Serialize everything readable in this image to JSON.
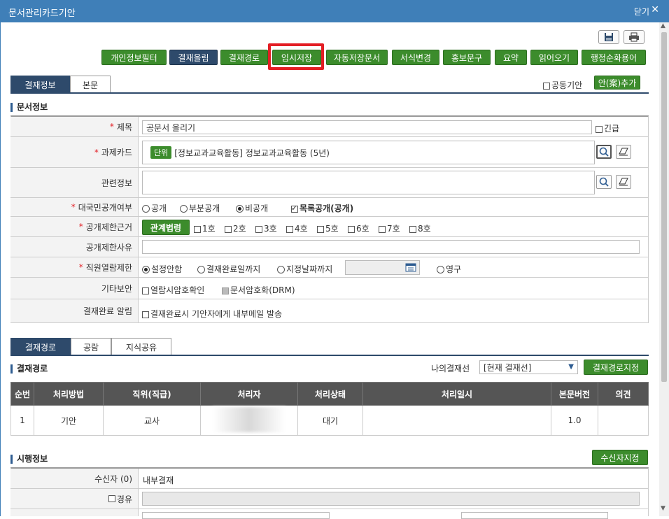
{
  "window": {
    "title": "문서관리카드기안",
    "close_label": "닫기"
  },
  "toolbar": {
    "buttons": [
      "개인정보필터",
      "결재올림",
      "결재경로",
      "임시저장",
      "자동저장문서",
      "서식변경",
      "홍보문구",
      "요약",
      "읽어오기",
      "행정순화용어"
    ]
  },
  "tabs_top": [
    "결재정보",
    "본문"
  ],
  "joint_draft_label": "공동기안",
  "add_draft_label": "안(案)추가",
  "doc_info": {
    "section_title": "문서정보",
    "title_label": "제목",
    "title_value": "공문서 올리기",
    "urgent_label": "긴급",
    "task_card_label": "과제카드",
    "task_tag": "단위",
    "task_value": "[정보교과교육활동] 정보교과교육활동 (5년)",
    "related_label": "관련정보",
    "public_label": "대국민공개여부",
    "public_options": [
      "공개",
      "부분공개",
      "비공개"
    ],
    "list_public_label": "목록공개(공개)",
    "restrict_basis_label": "공개제한근거",
    "law_button": "관계법령",
    "clauses": [
      "1호",
      "2호",
      "3호",
      "4호",
      "5호",
      "6호",
      "7호",
      "8호"
    ],
    "restrict_reason_label": "공개제한사유",
    "staff_view_label": "직원열람제한",
    "staff_view_options": [
      "설정안함",
      "결재완료일까지",
      "지정날짜까지"
    ],
    "permanent_label": "영구",
    "etc_security_label": "기타보안",
    "view_password_label": "열람시암호확인",
    "drm_label": "문서암호화(DRM)",
    "complete_notice_label": "결재완료 알림",
    "complete_notice_text": "결재완료시 기안자에게 내부메일 발송"
  },
  "tabs_mid": [
    "결재경로",
    "공람",
    "지식공유"
  ],
  "approval": {
    "section_title": "결재경로",
    "my_line_label": "나의결재선",
    "my_line_value": "[현재 결재선]",
    "set_path_button": "결재경로지정",
    "columns": [
      "순번",
      "처리방법",
      "직위(직급)",
      "처리자",
      "처리상태",
      "처리일시",
      "본문버전",
      "의견"
    ],
    "rows": [
      {
        "no": "1",
        "method": "기안",
        "position": "교사",
        "handler": "",
        "status": "대기",
        "datetime": "",
        "version": "1.0",
        "opinion": ""
      }
    ]
  },
  "execution": {
    "section_title": "시행정보",
    "set_receiver_button": "수신자지정",
    "receiver_label": "수신자 (0)",
    "receiver_value": "내부결재",
    "via_label": "경유"
  },
  "colors": {
    "title_bar": "#3f7fb8",
    "green_button": "#3c8c2c",
    "navy": "#2e4a6b",
    "highlight": "#e31e24"
  }
}
